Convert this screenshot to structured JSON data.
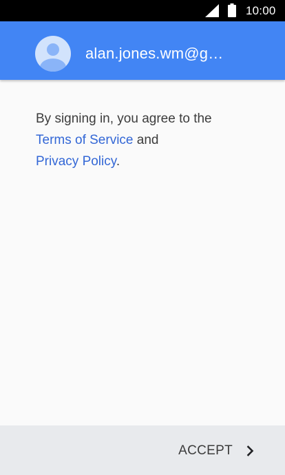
{
  "status_bar": {
    "time": "10:00",
    "icons": [
      "signal-icon",
      "battery-icon"
    ]
  },
  "header": {
    "avatar_icon": "account-circle-icon",
    "email": "alan.jones.wm@g…"
  },
  "body": {
    "text_before": "By signing in, you agree to the",
    "terms_link": "Terms of Service",
    "text_and": "and",
    "privacy_link": "Privacy Policy",
    "text_end": "."
  },
  "footer": {
    "accept_label": "ACCEPT",
    "accept_icon": "chevron-right-icon"
  },
  "colors": {
    "header_bg": "#4285f4",
    "link": "#3367d6",
    "page_bg": "#fafafa",
    "footer_bg": "#e8eaed"
  }
}
